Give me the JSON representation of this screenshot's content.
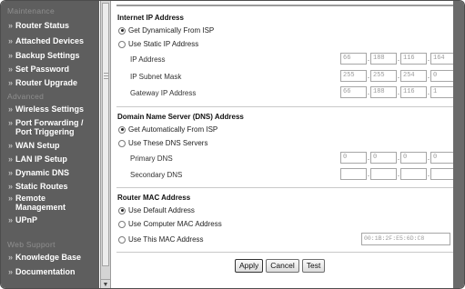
{
  "sidebar": {
    "sections": [
      {
        "label": "Maintenance"
      },
      {
        "label": "Advanced"
      },
      {
        "label": "Web Support"
      }
    ],
    "items": [
      {
        "label": "Router Status"
      },
      {
        "label": "Attached Devices"
      },
      {
        "label": "Backup Settings"
      },
      {
        "label": "Set Password"
      },
      {
        "label": "Router Upgrade"
      },
      {
        "label": "Wireless Settings"
      },
      {
        "label": "Port Forwarding /",
        "label2": "Port Triggering"
      },
      {
        "label": "WAN Setup"
      },
      {
        "label": "LAN IP Setup"
      },
      {
        "label": "Dynamic DNS"
      },
      {
        "label": "Static Routes"
      },
      {
        "label": "Remote",
        "label2": "Management"
      },
      {
        "label": "UPnP"
      },
      {
        "label": "Knowledge Base"
      },
      {
        "label": "Documentation"
      }
    ]
  },
  "internet_ip": {
    "title": "Internet IP Address",
    "option_dynamic": "Get Dynamically From ISP",
    "option_static": "Use Static IP Address",
    "ip_label": "IP Address",
    "ip": [
      "66",
      "188",
      "116",
      "164"
    ],
    "mask_label": "IP Subnet Mask",
    "mask": [
      "255",
      "255",
      "254",
      "0"
    ],
    "gateway_label": "Gateway IP Address",
    "gateway": [
      "66",
      "188",
      "116",
      "1"
    ],
    "selected": "dynamic"
  },
  "dns": {
    "title": "Domain Name Server (DNS) Address",
    "option_auto": "Get Automatically From ISP",
    "option_manual": "Use These DNS Servers",
    "primary_label": "Primary DNS",
    "primary": [
      "0",
      "0",
      "0",
      "0"
    ],
    "secondary_label": "Secondary DNS",
    "secondary": [
      "",
      "",
      "",
      ""
    ],
    "selected": "auto"
  },
  "mac": {
    "title": "Router MAC Address",
    "option_default": "Use Default Address",
    "option_computer": "Use Computer MAC Address",
    "option_this": "Use This MAC Address",
    "value": "00:1B:2F:E5:6D:C8",
    "selected": "default"
  },
  "buttons": {
    "apply": "Apply",
    "cancel": "Cancel",
    "test": "Test"
  }
}
